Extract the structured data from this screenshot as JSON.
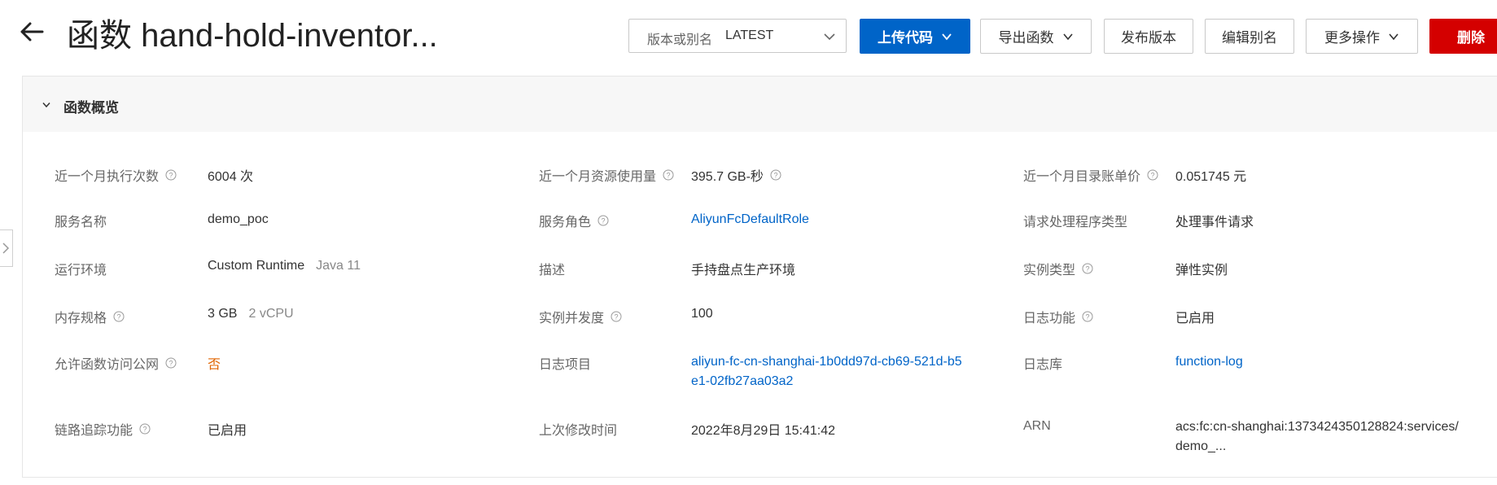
{
  "header": {
    "title": "函数 hand-hold-inventor...",
    "version_select": {
      "label": "版本或别名",
      "value": "LATEST"
    },
    "buttons": {
      "upload_code": "上传代码",
      "export_function": "导出函数",
      "publish_version": "发布版本",
      "edit_alias": "编辑别名",
      "more_actions": "更多操作",
      "delete": "删除"
    }
  },
  "overview": {
    "title": "函数概览",
    "rows": [
      [
        {
          "label": "近一个月执行次数",
          "value": "6004 次"
        },
        {
          "label": "近一个月资源使用量",
          "value": "395.7 GB-秒"
        },
        {
          "label": "近一个月目录账单价",
          "value": "0.051745 元"
        }
      ],
      [
        {
          "label": "服务名称",
          "value": "demo_poc"
        },
        {
          "label": "服务角色",
          "value": "AliyunFcDefaultRole"
        },
        {
          "label": "请求处理程序类型",
          "value": "处理事件请求"
        }
      ],
      [
        {
          "label": "运行环境",
          "value": "Custom Runtime",
          "sub": "Java 11"
        },
        {
          "label": "描述",
          "value": "手持盘点生产环境"
        },
        {
          "label": "实例类型",
          "value": "弹性实例"
        }
      ],
      [
        {
          "label": "内存规格",
          "value": "3 GB",
          "sub": "2 vCPU"
        },
        {
          "label": "实例并发度",
          "value": "100"
        },
        {
          "label": "日志功能",
          "value": "已启用"
        }
      ],
      [
        {
          "label": "允许函数访问公网",
          "value": "否"
        },
        {
          "label": "日志项目",
          "value": "aliyun-fc-cn-shanghai-1b0dd97d-cb69-521d-b5e1-02fb27aa03a2"
        },
        {
          "label": "日志库",
          "value": "function-log"
        }
      ],
      [
        {
          "label": "链路追踪功能",
          "value": "已启用"
        },
        {
          "label": "上次修改时间",
          "value": "2022年8月29日 15:41:42"
        },
        {
          "label": "ARN",
          "value": "acs:fc:cn-shanghai:1373424350128824:services/demo_..."
        }
      ]
    ]
  },
  "colors": {
    "primary": "#0064c8",
    "danger": "#d40000",
    "warning": "#e06400"
  },
  "icons": [
    "back-arrow-icon",
    "chevron-down-icon",
    "help-circle-icon",
    "collapse-chevron-icon",
    "chevron-right-icon"
  ]
}
